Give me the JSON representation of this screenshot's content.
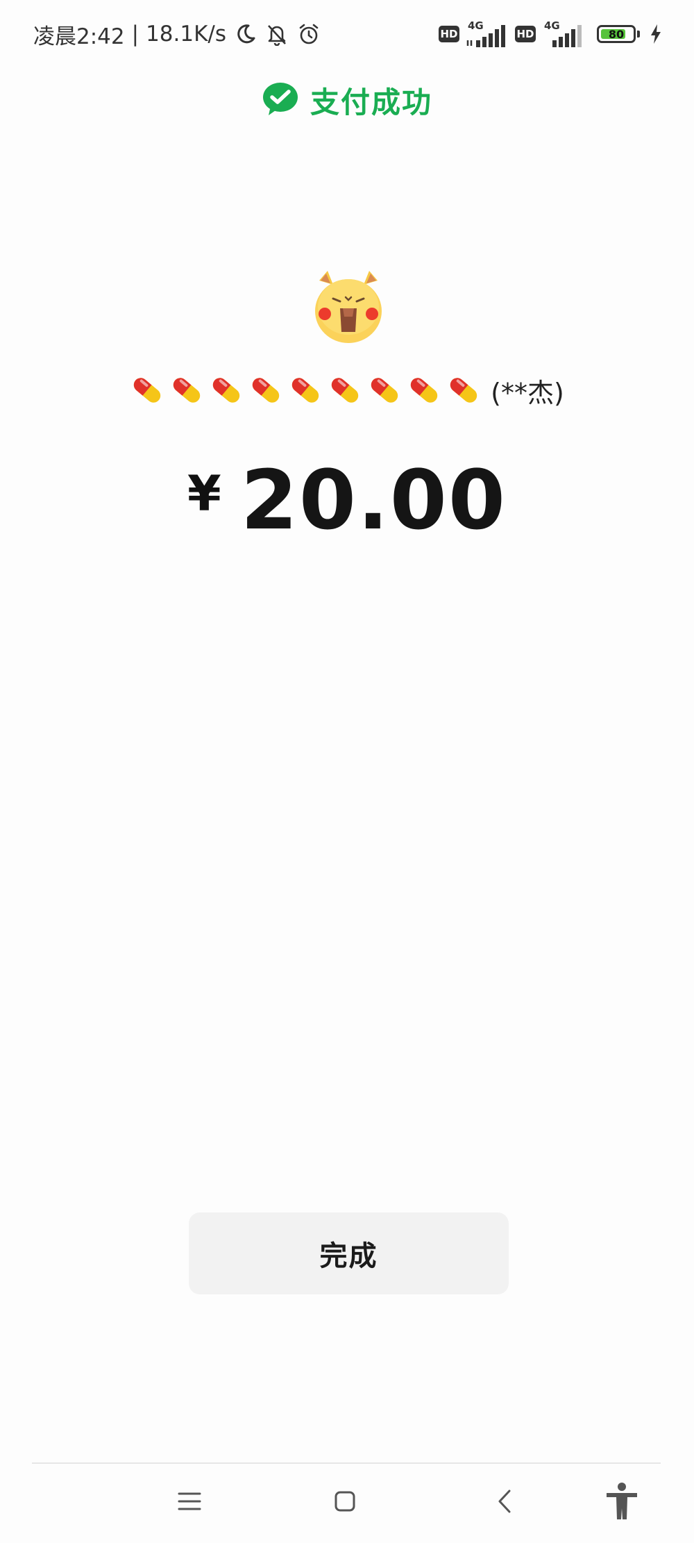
{
  "status_bar": {
    "time": "凌晨2:42",
    "separator": "|",
    "net_speed": "18.1K/s",
    "icons": [
      "moon-icon",
      "bell-off-icon",
      "alarm-icon"
    ],
    "sim1": {
      "hd": "HD",
      "type": "4G"
    },
    "sim2": {
      "hd": "HD",
      "type": "4G"
    },
    "battery_level": "80",
    "charging": true
  },
  "header": {
    "title": "支付成功",
    "icon": "wechat-pay-check-icon",
    "color": "#1aad52"
  },
  "payee": {
    "avatar": "yellow-cartoon-avatar",
    "name_emoji": "pill",
    "name_emoji_count": 9,
    "name_suffix": "(**杰)"
  },
  "amount": {
    "currency": "¥",
    "value": "20.00"
  },
  "done_button": {
    "label": "完成"
  },
  "nav_bar": {
    "items": [
      "menu-icon",
      "home-icon",
      "back-icon",
      "accessibility-icon"
    ]
  }
}
